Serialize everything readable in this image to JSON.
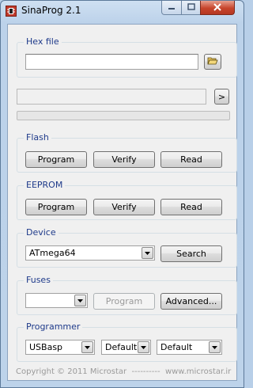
{
  "window": {
    "title": "SinaProg 2.1",
    "app_icon": "chip-icon",
    "controls": [
      "minimize-icon",
      "maximize-icon",
      "close-icon"
    ]
  },
  "hex_file": {
    "legend": "Hex file",
    "path_value": "",
    "browse_icon": "folder-open-icon"
  },
  "command": {
    "value": "",
    "run_label": ">",
    "progress": 0
  },
  "flash": {
    "legend": "Flash",
    "program_label": "Program",
    "verify_label": "Verify",
    "read_label": "Read"
  },
  "eeprom": {
    "legend": "EEPROM",
    "program_label": "Program",
    "verify_label": "Verify",
    "read_label": "Read"
  },
  "device": {
    "legend": "Device",
    "selected": "ATmega64",
    "search_label": "Search"
  },
  "fuses": {
    "legend": "Fuses",
    "selected": "",
    "program_label": "Program",
    "program_enabled": false,
    "advanced_label": "Advanced..."
  },
  "programmer": {
    "legend": "Programmer",
    "type": "USBasp",
    "port": "Default",
    "speed": "Default"
  },
  "footer": {
    "copyright": "Copyright © 2011 Microstar",
    "separator": "----------",
    "website": "www.microstar.ir"
  }
}
